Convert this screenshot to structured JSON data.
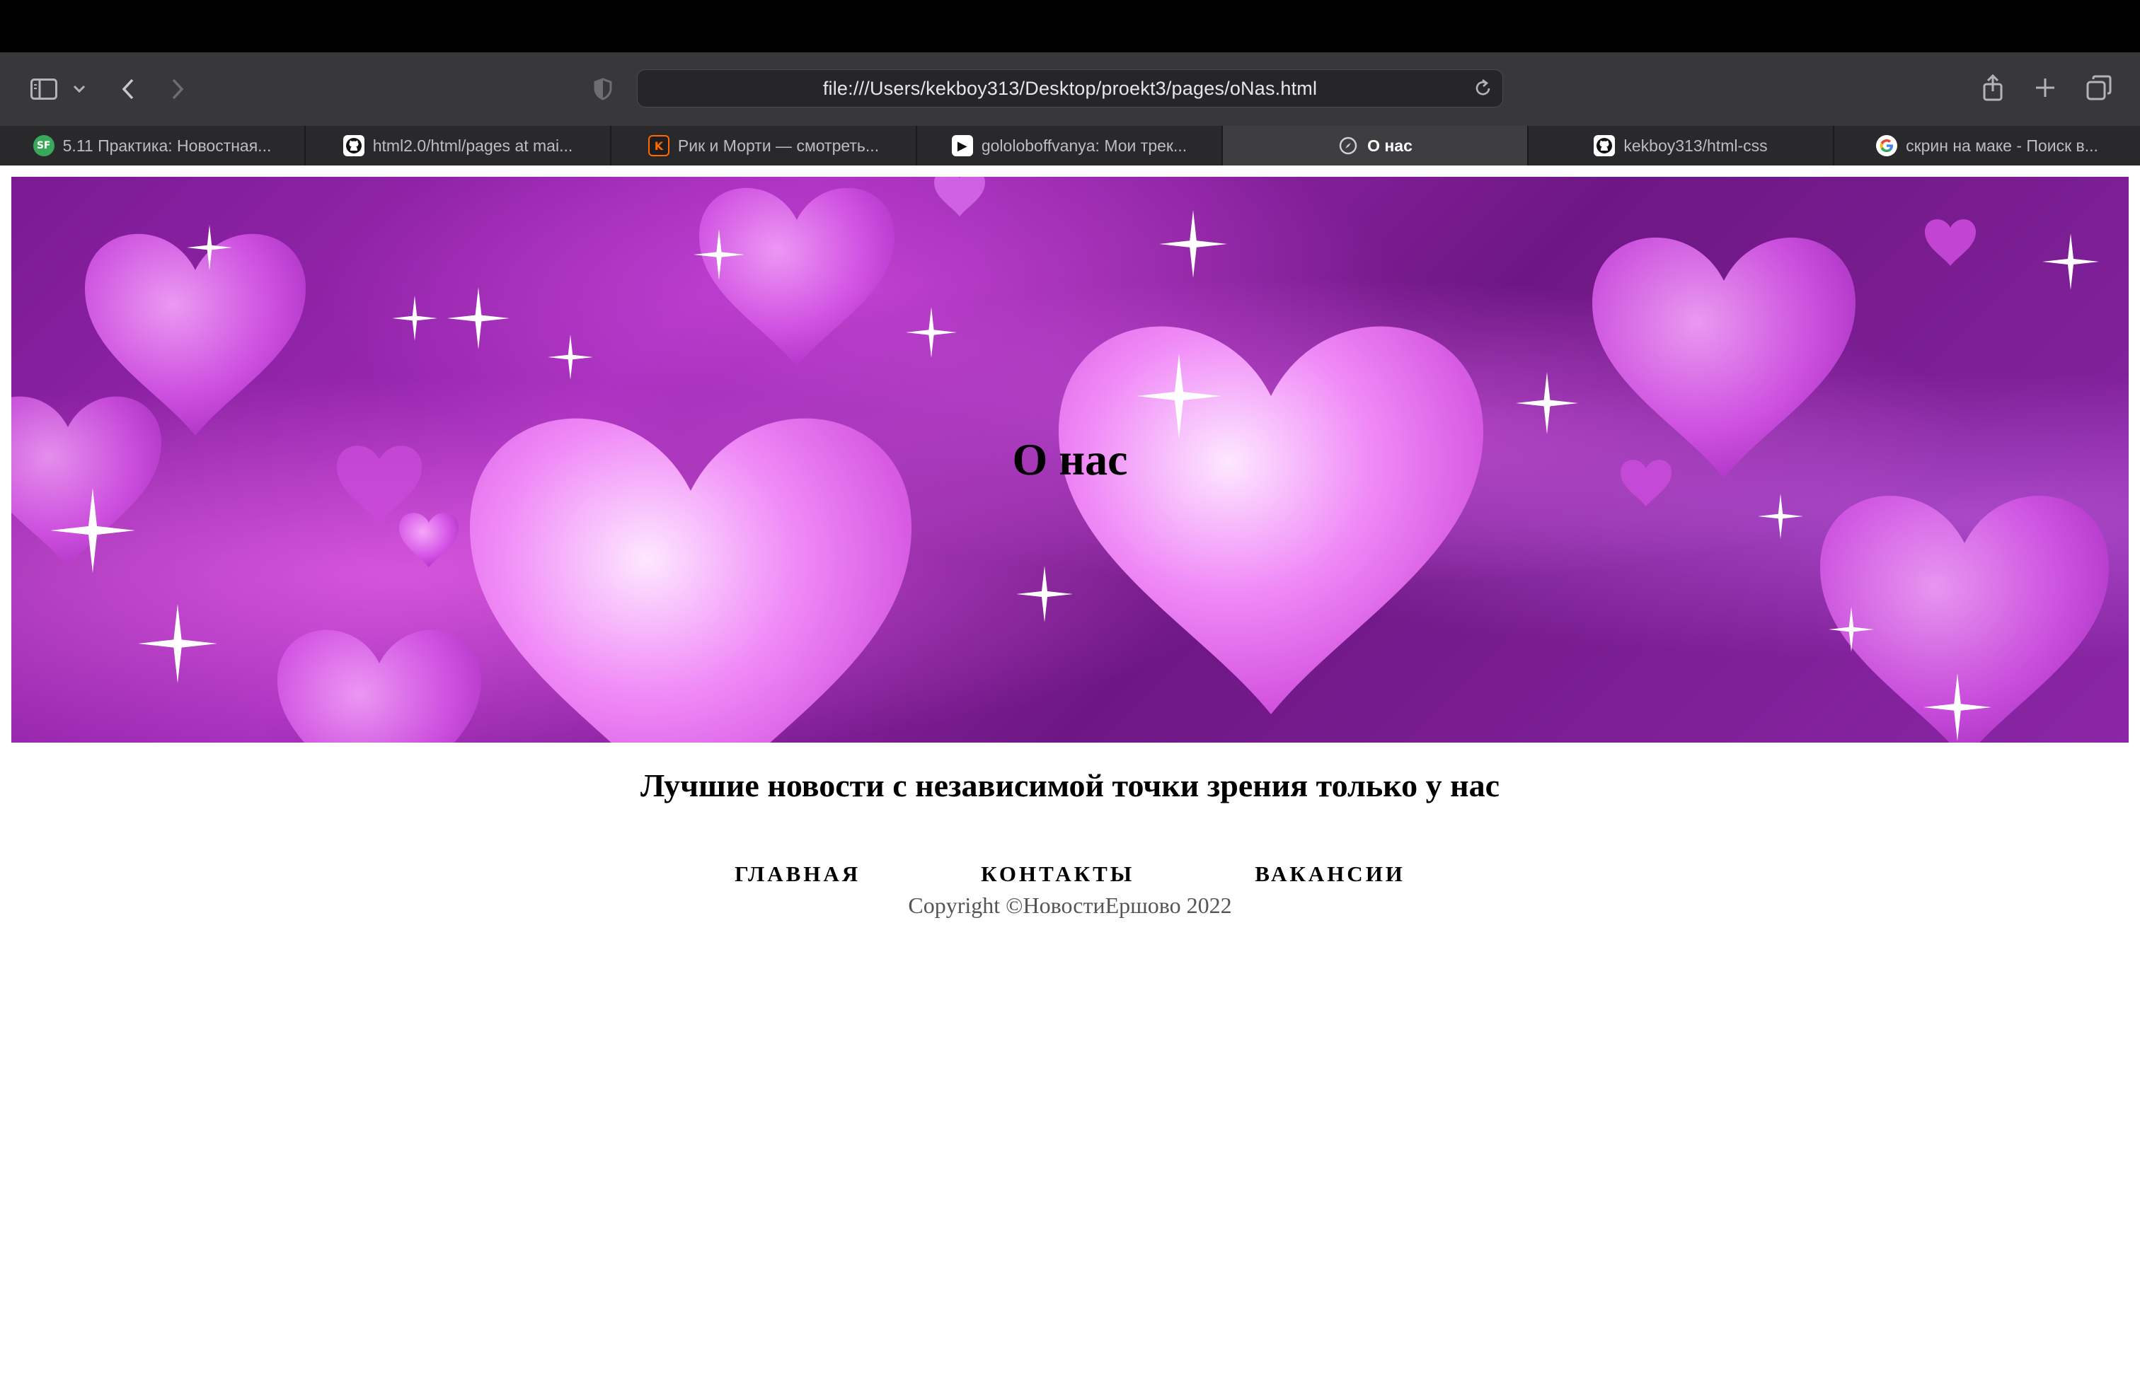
{
  "browser": {
    "url": "file:///Users/kekboy313/Desktop/proekt3/pages/oNas.html",
    "tabs": [
      {
        "label": "5.11 Практика: Новостная...",
        "favicon_text": "SF",
        "favicon_color": "#3aa85a"
      },
      {
        "label": "html2.0/html/pages at mai...",
        "favicon_text": "",
        "favicon_color": "#ffffff",
        "icon": "github-icon"
      },
      {
        "label": "Рик и Морти — смотреть...",
        "favicon_text": "K",
        "favicon_color": "#1e1e1e",
        "icon": "kinopoisk-icon"
      },
      {
        "label": "gololoboffvanya: Мои трек...",
        "favicon_text": "▶",
        "favicon_color": "#ffffff",
        "icon": "play-icon"
      },
      {
        "label": "О нас",
        "favicon_text": "",
        "favicon_color": "#3e3e41",
        "icon": "compass-icon",
        "active": true
      },
      {
        "label": "kekboy313/html-css",
        "favicon_text": "",
        "favicon_color": "#ffffff",
        "icon": "github-icon"
      },
      {
        "label": "скрин на маке - Поиск в...",
        "favicon_text": "G",
        "favicon_color": "#ffffff",
        "icon": "google-icon"
      }
    ]
  },
  "page": {
    "hero_title": "О нас",
    "subtitle": "Лучшие новости с независимой точки зрения только у нас",
    "nav": {
      "home": "ГЛАВНАЯ",
      "contacts": "КОНТАКТЫ",
      "vacancies": "ВАКАНСИИ"
    },
    "copyright": "Copyright ©НовостиЕршово 2022"
  },
  "colors": {
    "toolbar": "#38383a",
    "tabbar": "#29292b",
    "hero_accent": "#a12bb8"
  }
}
